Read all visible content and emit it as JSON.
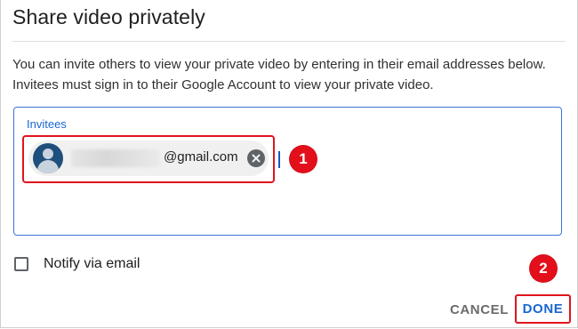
{
  "dialog": {
    "title": "Share video privately",
    "description": "You can invite others to view your private video by entering in their email addresses below. Invitees must sign in to their Google Account to view your private video."
  },
  "invitees": {
    "label": "Invitees",
    "chips": [
      {
        "email_domain": "@gmail.com",
        "avatar_icon": "person-avatar-icon",
        "remove_icon": "close-circle-icon"
      }
    ]
  },
  "notify": {
    "label": "Notify via email",
    "checked": false
  },
  "actions": {
    "cancel_label": "CANCEL",
    "done_label": "DONE"
  },
  "annotations": {
    "badge_1": "1",
    "badge_2": "2",
    "color": "#e3101c"
  },
  "colors": {
    "accent": "#1a66d2",
    "highlight": "#e0141e"
  }
}
